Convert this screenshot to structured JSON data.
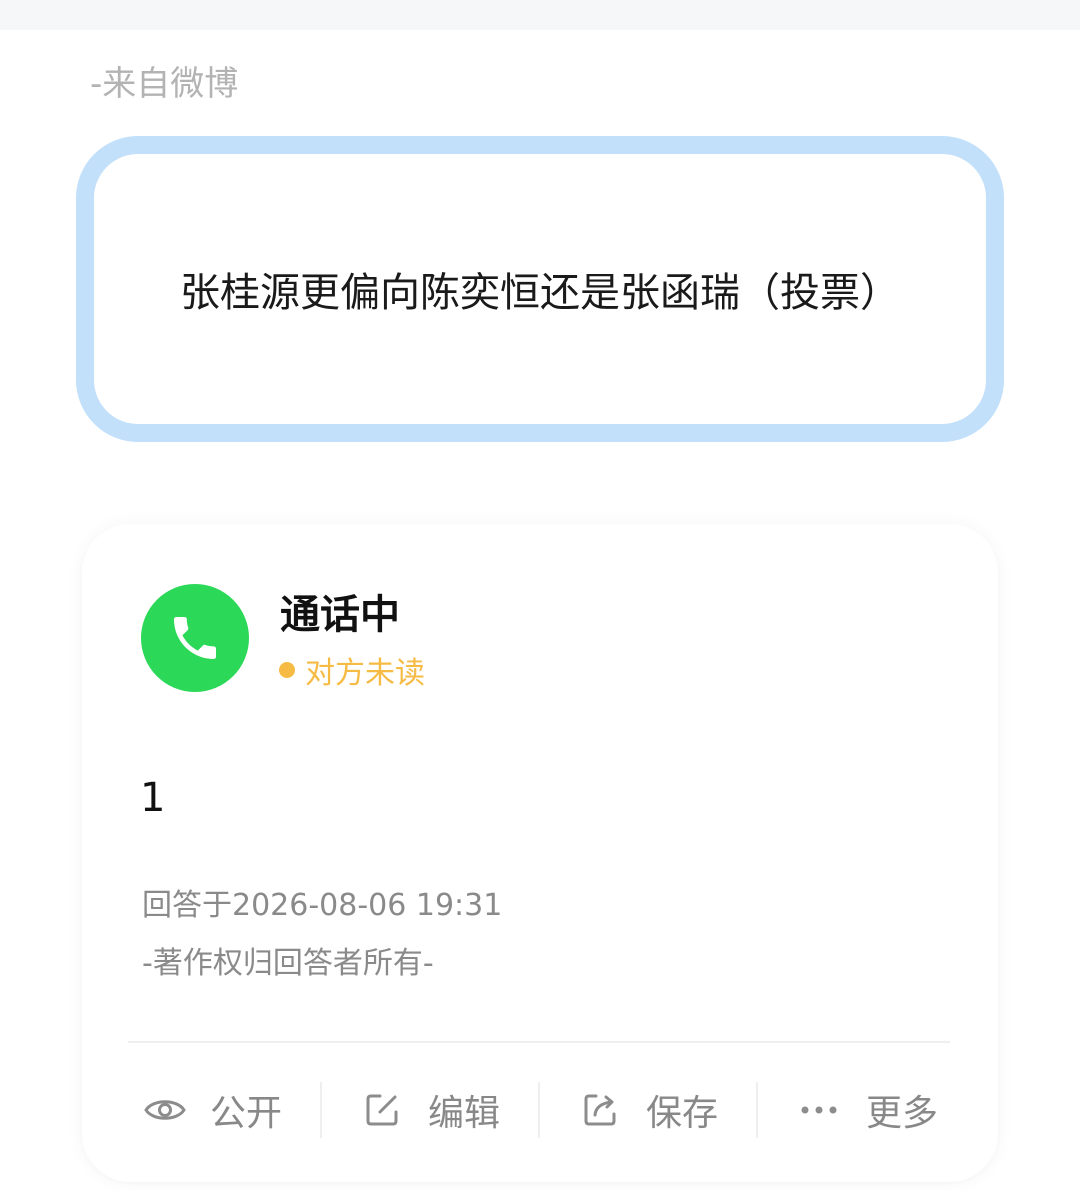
{
  "header": {
    "source_label": "-来自微博"
  },
  "question": {
    "title": "张桂源更偏向陈奕恒还是张函瑞（投票）"
  },
  "answer": {
    "caller_title": "通话中",
    "status_text": "对方未读",
    "body": "1",
    "answered_at": "回答于2026-08-06 19:31",
    "copyright": "-著作权归回答者所有-",
    "colors": {
      "avatar_bg": "#2bd858",
      "status": "#f6bb45",
      "question_border": "#c3e0fb"
    }
  },
  "actions": [
    {
      "label": "公开",
      "icon": "eye-icon"
    },
    {
      "label": "编辑",
      "icon": "edit-icon"
    },
    {
      "label": "保存",
      "icon": "share-icon"
    },
    {
      "label": "更多",
      "icon": "more-icon"
    }
  ]
}
